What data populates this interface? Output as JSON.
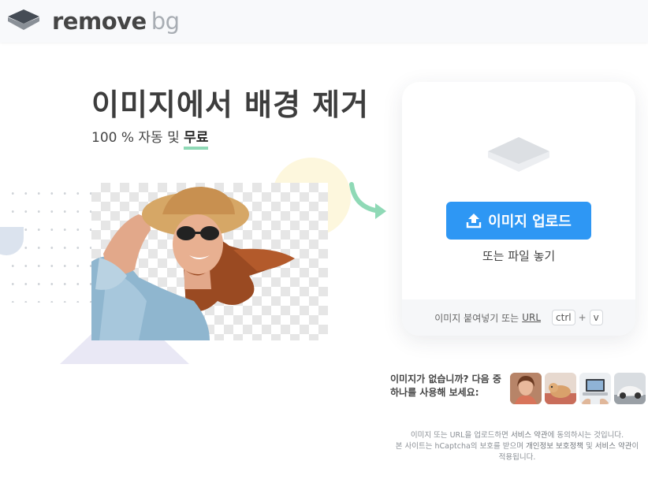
{
  "header": {
    "logo_word1": "remove",
    "logo_word2": "bg"
  },
  "hero": {
    "title": "이미지에서 배경 제거",
    "subtitle_prefix": "100 % 자동 및 ",
    "subtitle_free": "무료"
  },
  "upload_card": {
    "upload_button": "이미지 업로드",
    "drop_text": "또는 파일 놓기",
    "paste_text": "이미지 붙여넣기 또는",
    "url_link": "URL",
    "key_ctrl": "ctrl",
    "key_plus": "+",
    "key_v": "v"
  },
  "samples": {
    "prompt": "이미지가 없습니까? 다음 중 하나를 사용해 보세요:",
    "items": [
      "woman-portrait",
      "dog",
      "laptop",
      "car"
    ]
  },
  "legal": {
    "line1_a": "이미지 또는 URL을 업로드하면 ",
    "line1_link": "서비스 약관",
    "line1_b": "에 동의하시는 것입니다.",
    "line2_a": "본 사이트는 hCaptcha의 보호를 받으며 ",
    "line2_link1": "개인정보 보호정책",
    "line2_mid": " 및 ",
    "line2_link2": "서비스 약관",
    "line2_b": "이 적용됩니다."
  },
  "colors": {
    "accent": "#2e97f4",
    "underline": "#8fd9b6",
    "arrow": "#8fd9b6"
  }
}
